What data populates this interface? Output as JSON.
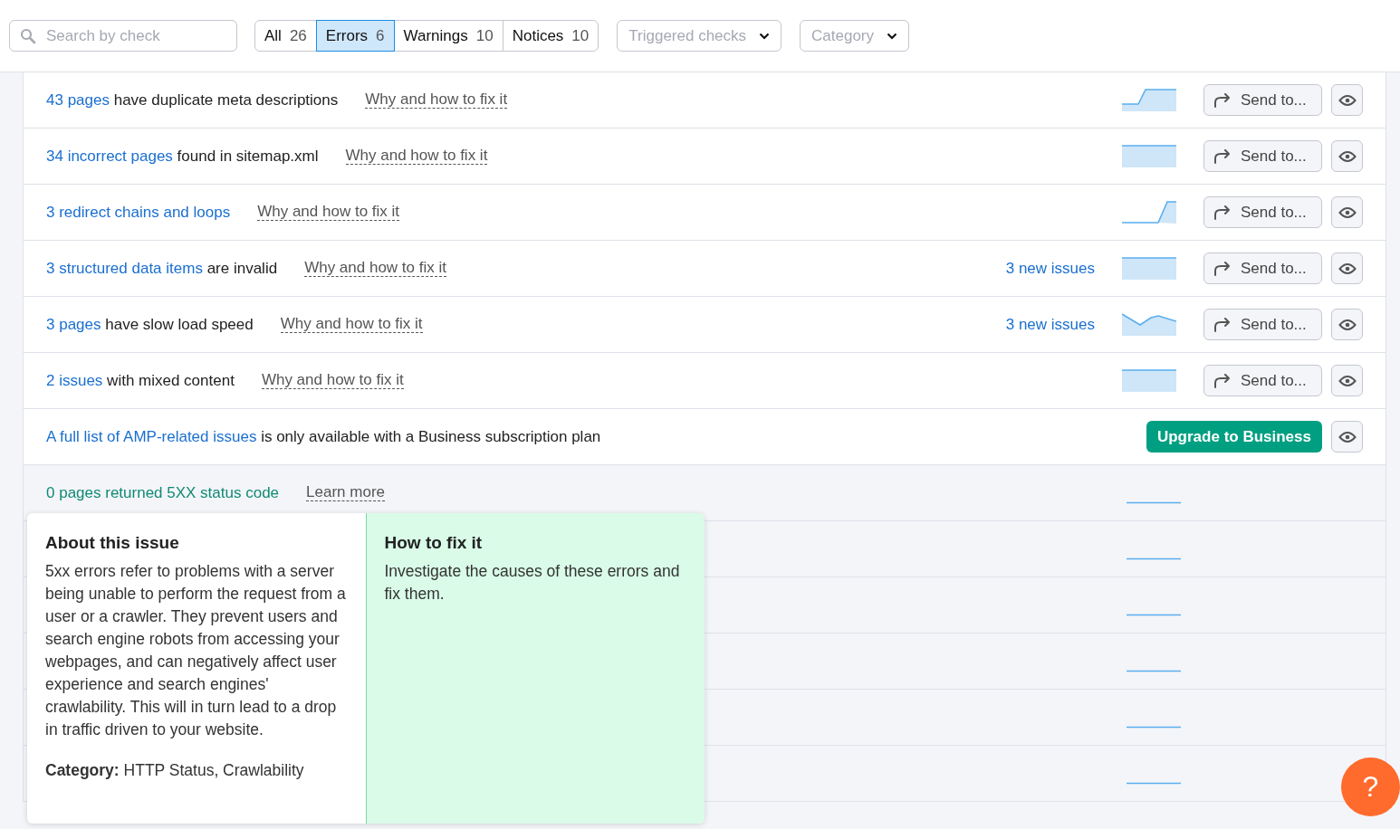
{
  "search": {
    "placeholder": "Search by check"
  },
  "filter_tabs": [
    {
      "label": "All",
      "count": "26",
      "selected": false
    },
    {
      "label": "Errors",
      "count": "6",
      "selected": true
    },
    {
      "label": "Warnings",
      "count": "10",
      "selected": false
    },
    {
      "label": "Notices",
      "count": "10",
      "selected": false
    }
  ],
  "dropdowns": [
    {
      "label": "Triggered checks"
    },
    {
      "label": "Category"
    }
  ],
  "checks": [
    {
      "kind": "issue",
      "link": "43 pages",
      "text": " have duplicate meta descriptions",
      "fix_link": "Why and how to fix it",
      "sparkline": {
        "kind": "step-up"
      },
      "send": "Send to..."
    },
    {
      "kind": "issue",
      "link": "34 incorrect pages",
      "text": " found in sitemap.xml",
      "fix_link": "Why and how to fix it",
      "sparkline": {
        "kind": "flat"
      },
      "send": "Send to..."
    },
    {
      "kind": "issue",
      "link": "3 redirect chains and loops",
      "fix_link": "Why and how to fix it",
      "sparkline": {
        "kind": "late-rise"
      },
      "send": "Send to..."
    },
    {
      "kind": "issue",
      "link": "3 structured data items",
      "text": " are invalid",
      "fix_link": "Why and how to fix it",
      "new_issues": "3 new issues",
      "sparkline": {
        "kind": "flat"
      },
      "send": "Send to..."
    },
    {
      "kind": "issue",
      "link": "3 pages",
      "text": " have slow load speed",
      "fix_link": "Why and how to fix it",
      "new_issues": "3 new issues",
      "sparkline": {
        "kind": "dip"
      },
      "send": "Send to..."
    },
    {
      "kind": "issue",
      "link": "2 issues",
      "text": " with mixed content",
      "fix_link": "Why and how to fix it",
      "sparkline": {
        "kind": "flat"
      },
      "send": "Send to..."
    },
    {
      "kind": "upsell",
      "link": "A full list of AMP-related issues",
      "text": " is only available with a Business subscription plan",
      "upgrade": "Upgrade to Business"
    },
    {
      "kind": "passed",
      "text": "0 pages returned 5XX status code",
      "fix_link": "Learn more",
      "sparkline": {
        "kind": "baseline"
      }
    },
    {
      "kind": "covered",
      "sparkline": {
        "kind": "baseline"
      }
    },
    {
      "kind": "covered",
      "sparkline": {
        "kind": "baseline"
      }
    },
    {
      "kind": "covered",
      "sparkline": {
        "kind": "baseline"
      }
    },
    {
      "kind": "covered",
      "sparkline": {
        "kind": "baseline"
      }
    },
    {
      "kind": "covered",
      "sparkline": {
        "kind": "baseline"
      }
    }
  ],
  "popover": {
    "about_title": "About this issue",
    "about_text": "5xx errors refer to problems with a server being unable to perform the request from a user or a crawler. They prevent users and search engine robots from accessing your webpages, and can negatively affect user experience and search engines' crawlability. This will in turn lead to a drop in traffic driven to your website.",
    "category": "**Category:** HTTP Status, Crawlability",
    "fix_title": "How to fix it",
    "fix_text": "Investigate the causes of these errors and fix them."
  },
  "help_button": {
    "label": "?"
  }
}
